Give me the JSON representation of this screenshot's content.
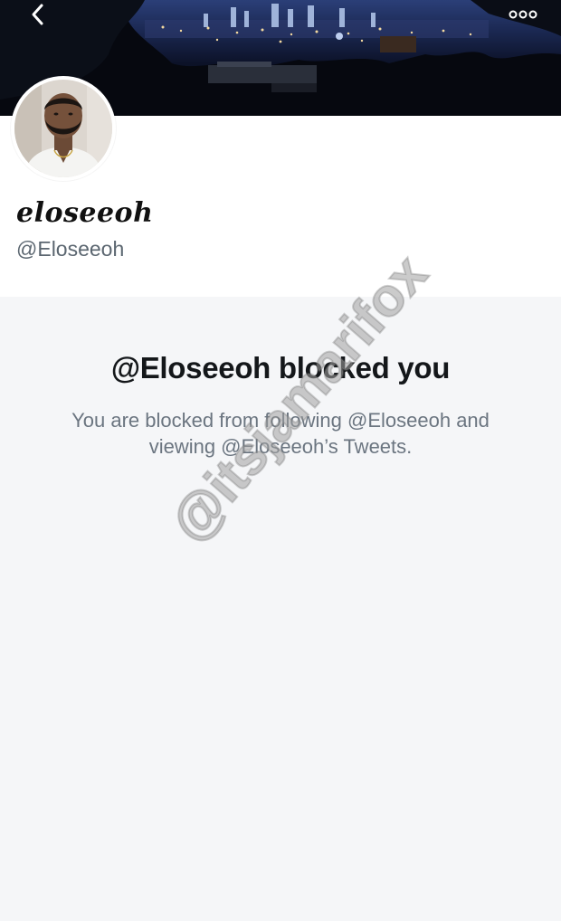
{
  "header": {
    "back_icon": "chevron-left-icon",
    "more_icon": "more-horizontal-icon"
  },
  "profile": {
    "display_name": "eloseeoh",
    "handle": "@Eloseeoh"
  },
  "blocked_notice": {
    "title": "@Eloseeoh blocked you",
    "line1": "You are blocked from following @Eloseeoh and",
    "line2": "viewing @Eloseeoh’s Tweets."
  },
  "watermark": {
    "text": "@itsjamarifox"
  },
  "colors": {
    "title_text": "#14171a",
    "secondary_text": "#6b7580",
    "page_background": "#f5f6f8"
  }
}
